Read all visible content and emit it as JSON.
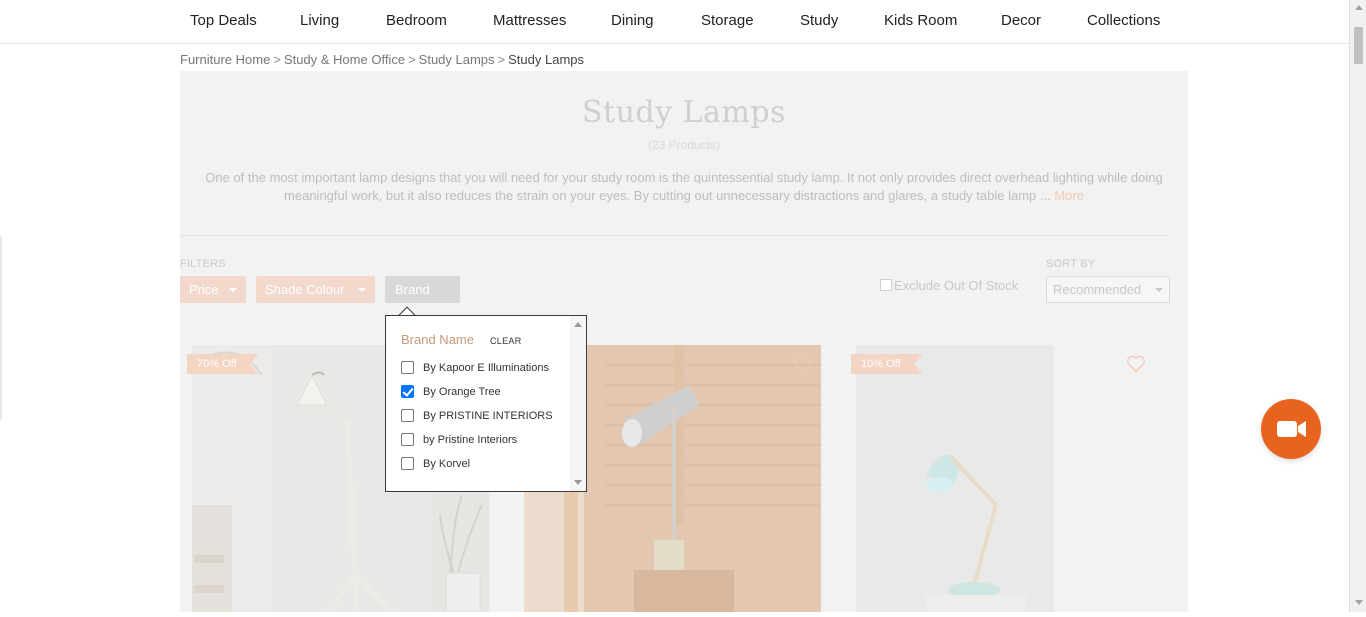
{
  "nav": {
    "items": [
      "Top Deals",
      "Living",
      "Bedroom",
      "Mattresses",
      "Dining",
      "Storage",
      "Study",
      "Kids Room",
      "Decor",
      "Collections"
    ]
  },
  "breadcrumb": {
    "items": [
      "Furniture Home",
      "Study & Home Office",
      "Study Lamps"
    ],
    "separator": ">",
    "current": "Study Lamps"
  },
  "category": {
    "title": "Study Lamps",
    "count": "(23 Products)",
    "description": "One of the most important lamp designs that you will need for your study room is the quintessential study lamp. It not only provides direct overhead lighting while doing meaningful work, but it also reduces the strain on your eyes. By cutting out unnecessary distractions and glares, a study table lamp ...",
    "more_label": "More"
  },
  "filters": {
    "label": "FILTERS",
    "buttons": [
      "Price",
      "Shade Colour",
      "Brand"
    ],
    "exclude_label": "Exclude Out Of Stock",
    "sort_label": "SORT BY",
    "sort_value": "Recommended"
  },
  "brand_popup": {
    "title": "Brand Name",
    "clear_label": "CLEAR",
    "options": [
      {
        "label": "By Kapoor E Illuminations",
        "checked": false
      },
      {
        "label": "By Orange Tree",
        "checked": true
      },
      {
        "label": "By PRISTINE INTERIORS",
        "checked": false
      },
      {
        "label": "by Pristine Interiors",
        "checked": false
      },
      {
        "label": "By Korvel",
        "checked": false
      }
    ]
  },
  "products": [
    {
      "badge": "70% Off"
    },
    {
      "badge": ""
    },
    {
      "badge": "10% Off"
    }
  ],
  "colors": {
    "accent": "#e8641e",
    "badge": "#f4d4c2",
    "checkbox": "#0075ff"
  },
  "icons": {
    "video": "video-camera-icon",
    "wishlist": "heart-outline-icon"
  }
}
